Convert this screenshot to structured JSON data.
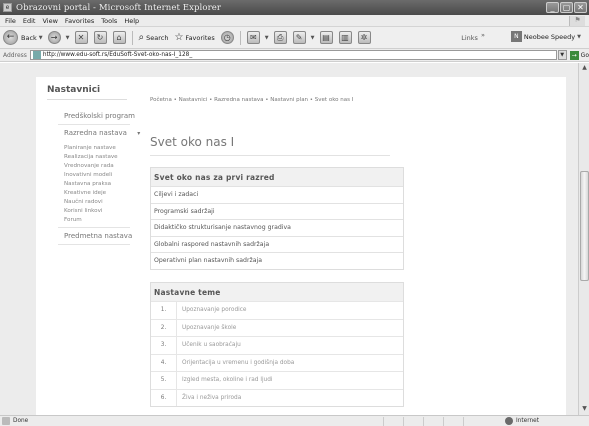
{
  "window": {
    "title": "Obrazovni portal - Microsoft Internet Explorer",
    "app_icon": "e",
    "buttons": [
      "_",
      "▢",
      "✕"
    ]
  },
  "menu": [
    "File",
    "Edit",
    "View",
    "Favorites",
    "Tools",
    "Help"
  ],
  "toolbar": {
    "back_label": "Back",
    "search_label": "Search",
    "favorites_label": "Favorites",
    "links_label": "Links",
    "links_chevron": "»",
    "neobee_label": "Neobee Speedy",
    "neobee_logo": "N"
  },
  "address": {
    "label": "Address",
    "url": "http://www.edu-soft.rs/EduSoft-Svet-oko-nas-I_128_",
    "go_label": "Go",
    "go_icon": "→"
  },
  "sidebar": {
    "title": "Nastavnici",
    "items": [
      {
        "label": "Predškolski program",
        "type": "main"
      },
      {
        "label": "Razredna nastava",
        "type": "main",
        "expanded": true,
        "chevron": "▾"
      },
      {
        "label": "Planiranje nastave",
        "type": "sub"
      },
      {
        "label": "Realizacija nastave",
        "type": "sub"
      },
      {
        "label": "Vrednovanje rada",
        "type": "sub"
      },
      {
        "label": "Inovativni modeli",
        "type": "sub"
      },
      {
        "label": "Nastavna praksa",
        "type": "sub"
      },
      {
        "label": "Kreativne ideje",
        "type": "sub"
      },
      {
        "label": "Naučni radovi",
        "type": "sub"
      },
      {
        "label": "Korisni linkovi",
        "type": "sub"
      },
      {
        "label": "Forum",
        "type": "sub"
      },
      {
        "label": "Predmetna nastava",
        "type": "main"
      }
    ]
  },
  "breadcrumb": "Početna  • Nastavnici  • Razredna nastava  • Nastavni plan  • Svet oko nas I",
  "page_title": "Svet oko nas I",
  "section1": {
    "heading": "Svet oko nas za prvi razred",
    "rows": [
      "Ciljevi i zadaci",
      "Programski sadržaji",
      "Didaktičko strukturisanje nastavnog gradiva",
      "Globalni raspored nastavnih sadržaja",
      "Operativni plan nastavnih sadržaja"
    ]
  },
  "section2": {
    "heading": "Nastavne teme",
    "rows": [
      {
        "num": "1.",
        "text": "Upoznavanje porodice"
      },
      {
        "num": "2.",
        "text": "Upoznavanje škole"
      },
      {
        "num": "3.",
        "text": "Učenik u saobraćaju"
      },
      {
        "num": "4.",
        "text": "Orijentacija u vremenu i godišnja doba"
      },
      {
        "num": "5.",
        "text": "Izgled mesta, okoline i rad ljudi"
      },
      {
        "num": "6.",
        "text": "Živa i neživa priroda"
      }
    ]
  },
  "status": {
    "text": "Done",
    "zone": "Internet"
  }
}
